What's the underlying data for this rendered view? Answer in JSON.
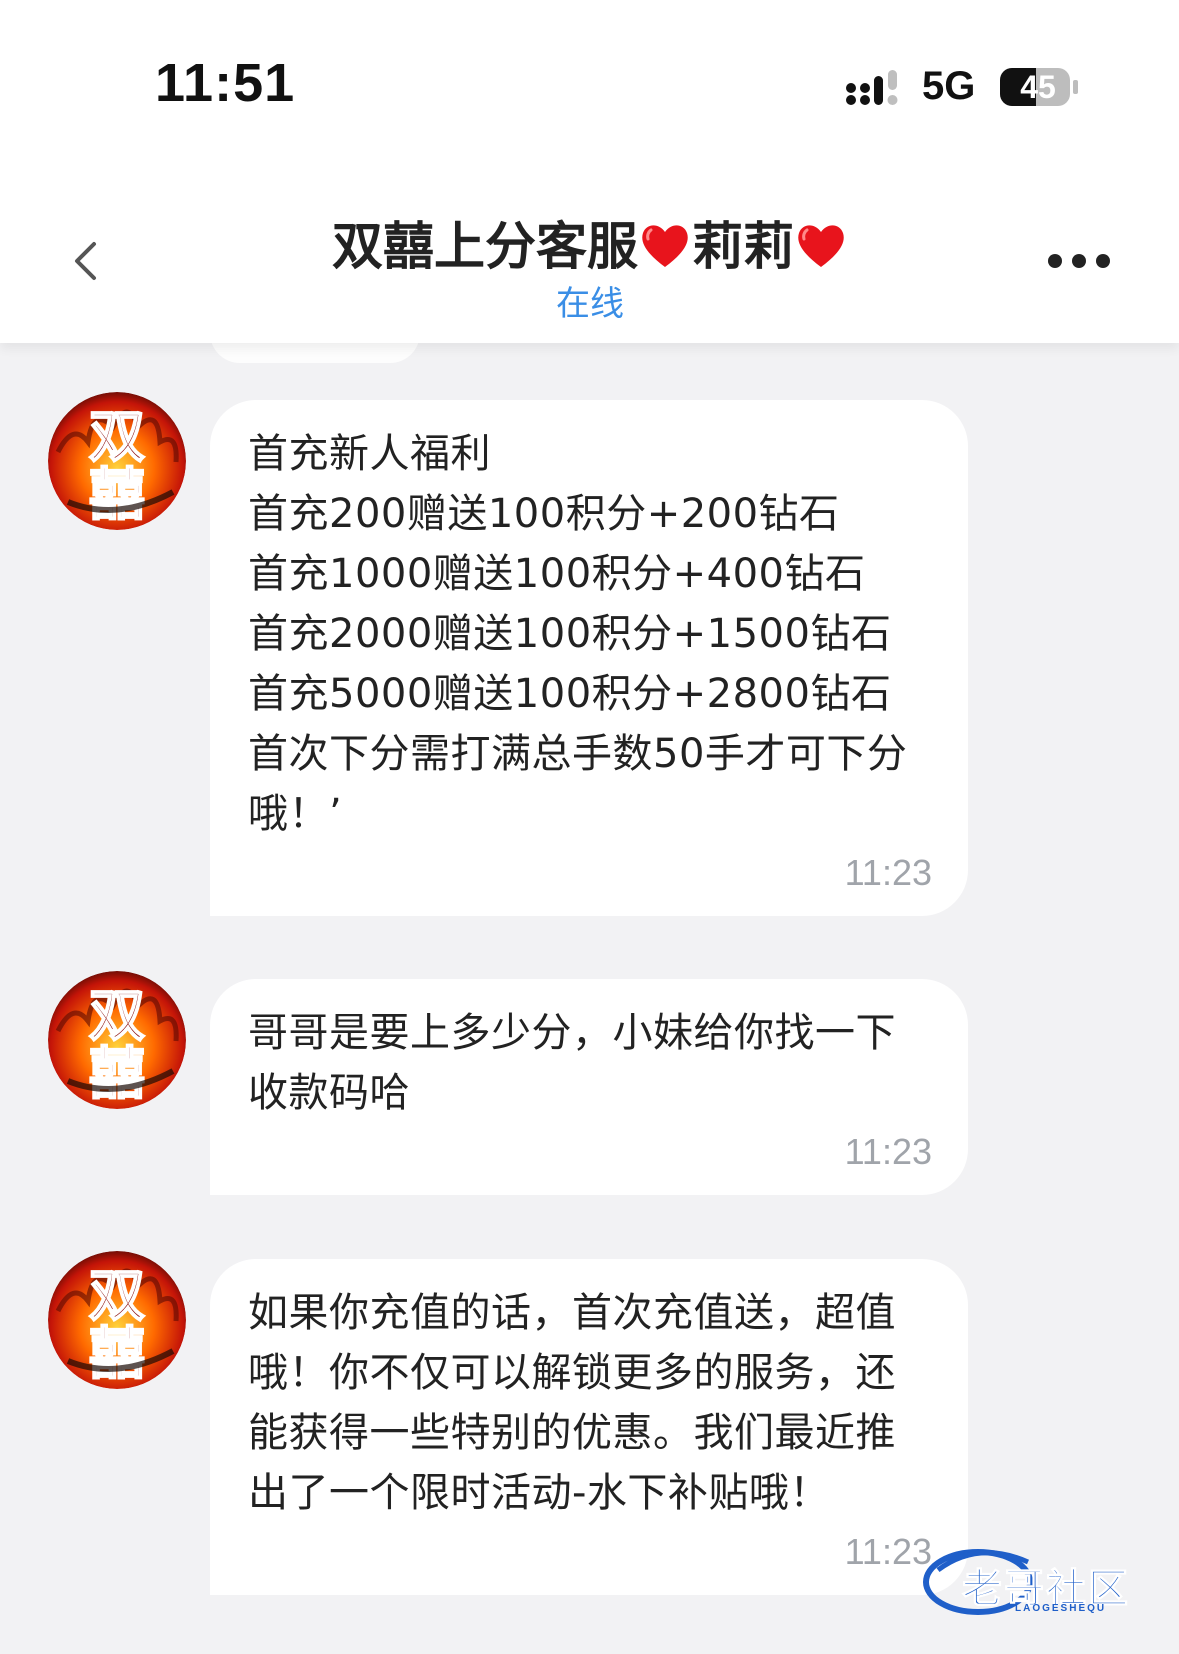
{
  "status_bar": {
    "time": "11:51",
    "network": "5G",
    "battery": "45"
  },
  "header": {
    "title_part1": "双囍上分客服",
    "title_part2": "莉莉",
    "status": "在线"
  },
  "colors": {
    "status_online": "#3a8ee6",
    "heart": "#e8141c",
    "bubble_bg": "#ffffff",
    "chat_bg": "#f2f2f4"
  },
  "avatar": {
    "text_top": "双",
    "text_bottom": "囍"
  },
  "messages": [
    {
      "text": "首充新人福利\n首充200赠送100积分+200钻石\n首充1000赠送100积分+400钻石\n首充2000赠送100积分+1500钻石\n首充5000赠送100积分+2800钻石\n首次下分需打满总手数50手才可下分哦！’",
      "time": "11:23"
    },
    {
      "text": "哥哥是要上多少分，小妹给你找一下收款码哈",
      "time": "11:23"
    },
    {
      "text": "如果你充值的话，首次充值送，超值哦！你不仅可以解锁更多的服务，还能获得一些特别的优惠。我们最近推出了一个限时活动-水下补贴哦！",
      "time": "11:23"
    }
  ],
  "watermark": {
    "text": "老哥社区",
    "sub": "LAOGESHEQU"
  }
}
